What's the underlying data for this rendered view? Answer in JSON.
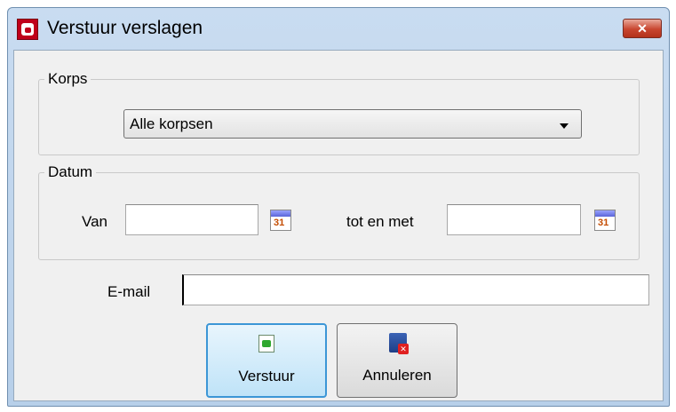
{
  "window": {
    "title": "Verstuur verslagen",
    "close_label": "✕"
  },
  "korps": {
    "group_title": "Korps",
    "selected": "Alle korpsen"
  },
  "datum": {
    "group_title": "Datum",
    "van_label": "Van",
    "van_value": "",
    "tot_label": "tot en met",
    "tot_value": "",
    "calendar_icon_text": "31"
  },
  "email": {
    "label": "E-mail",
    "value": ""
  },
  "buttons": {
    "send_label": "Verstuur",
    "cancel_label": "Annuleren"
  },
  "colors": {
    "title_bar": "#c9dcf1",
    "close_button": "#c8462f",
    "default_button_border": "#3c96d6",
    "app_icon": "#c0001a"
  },
  "icons": [
    "app-logo-icon",
    "close-icon",
    "chevron-down-icon",
    "calendar-icon",
    "send-report-icon",
    "cancel-icon"
  ]
}
